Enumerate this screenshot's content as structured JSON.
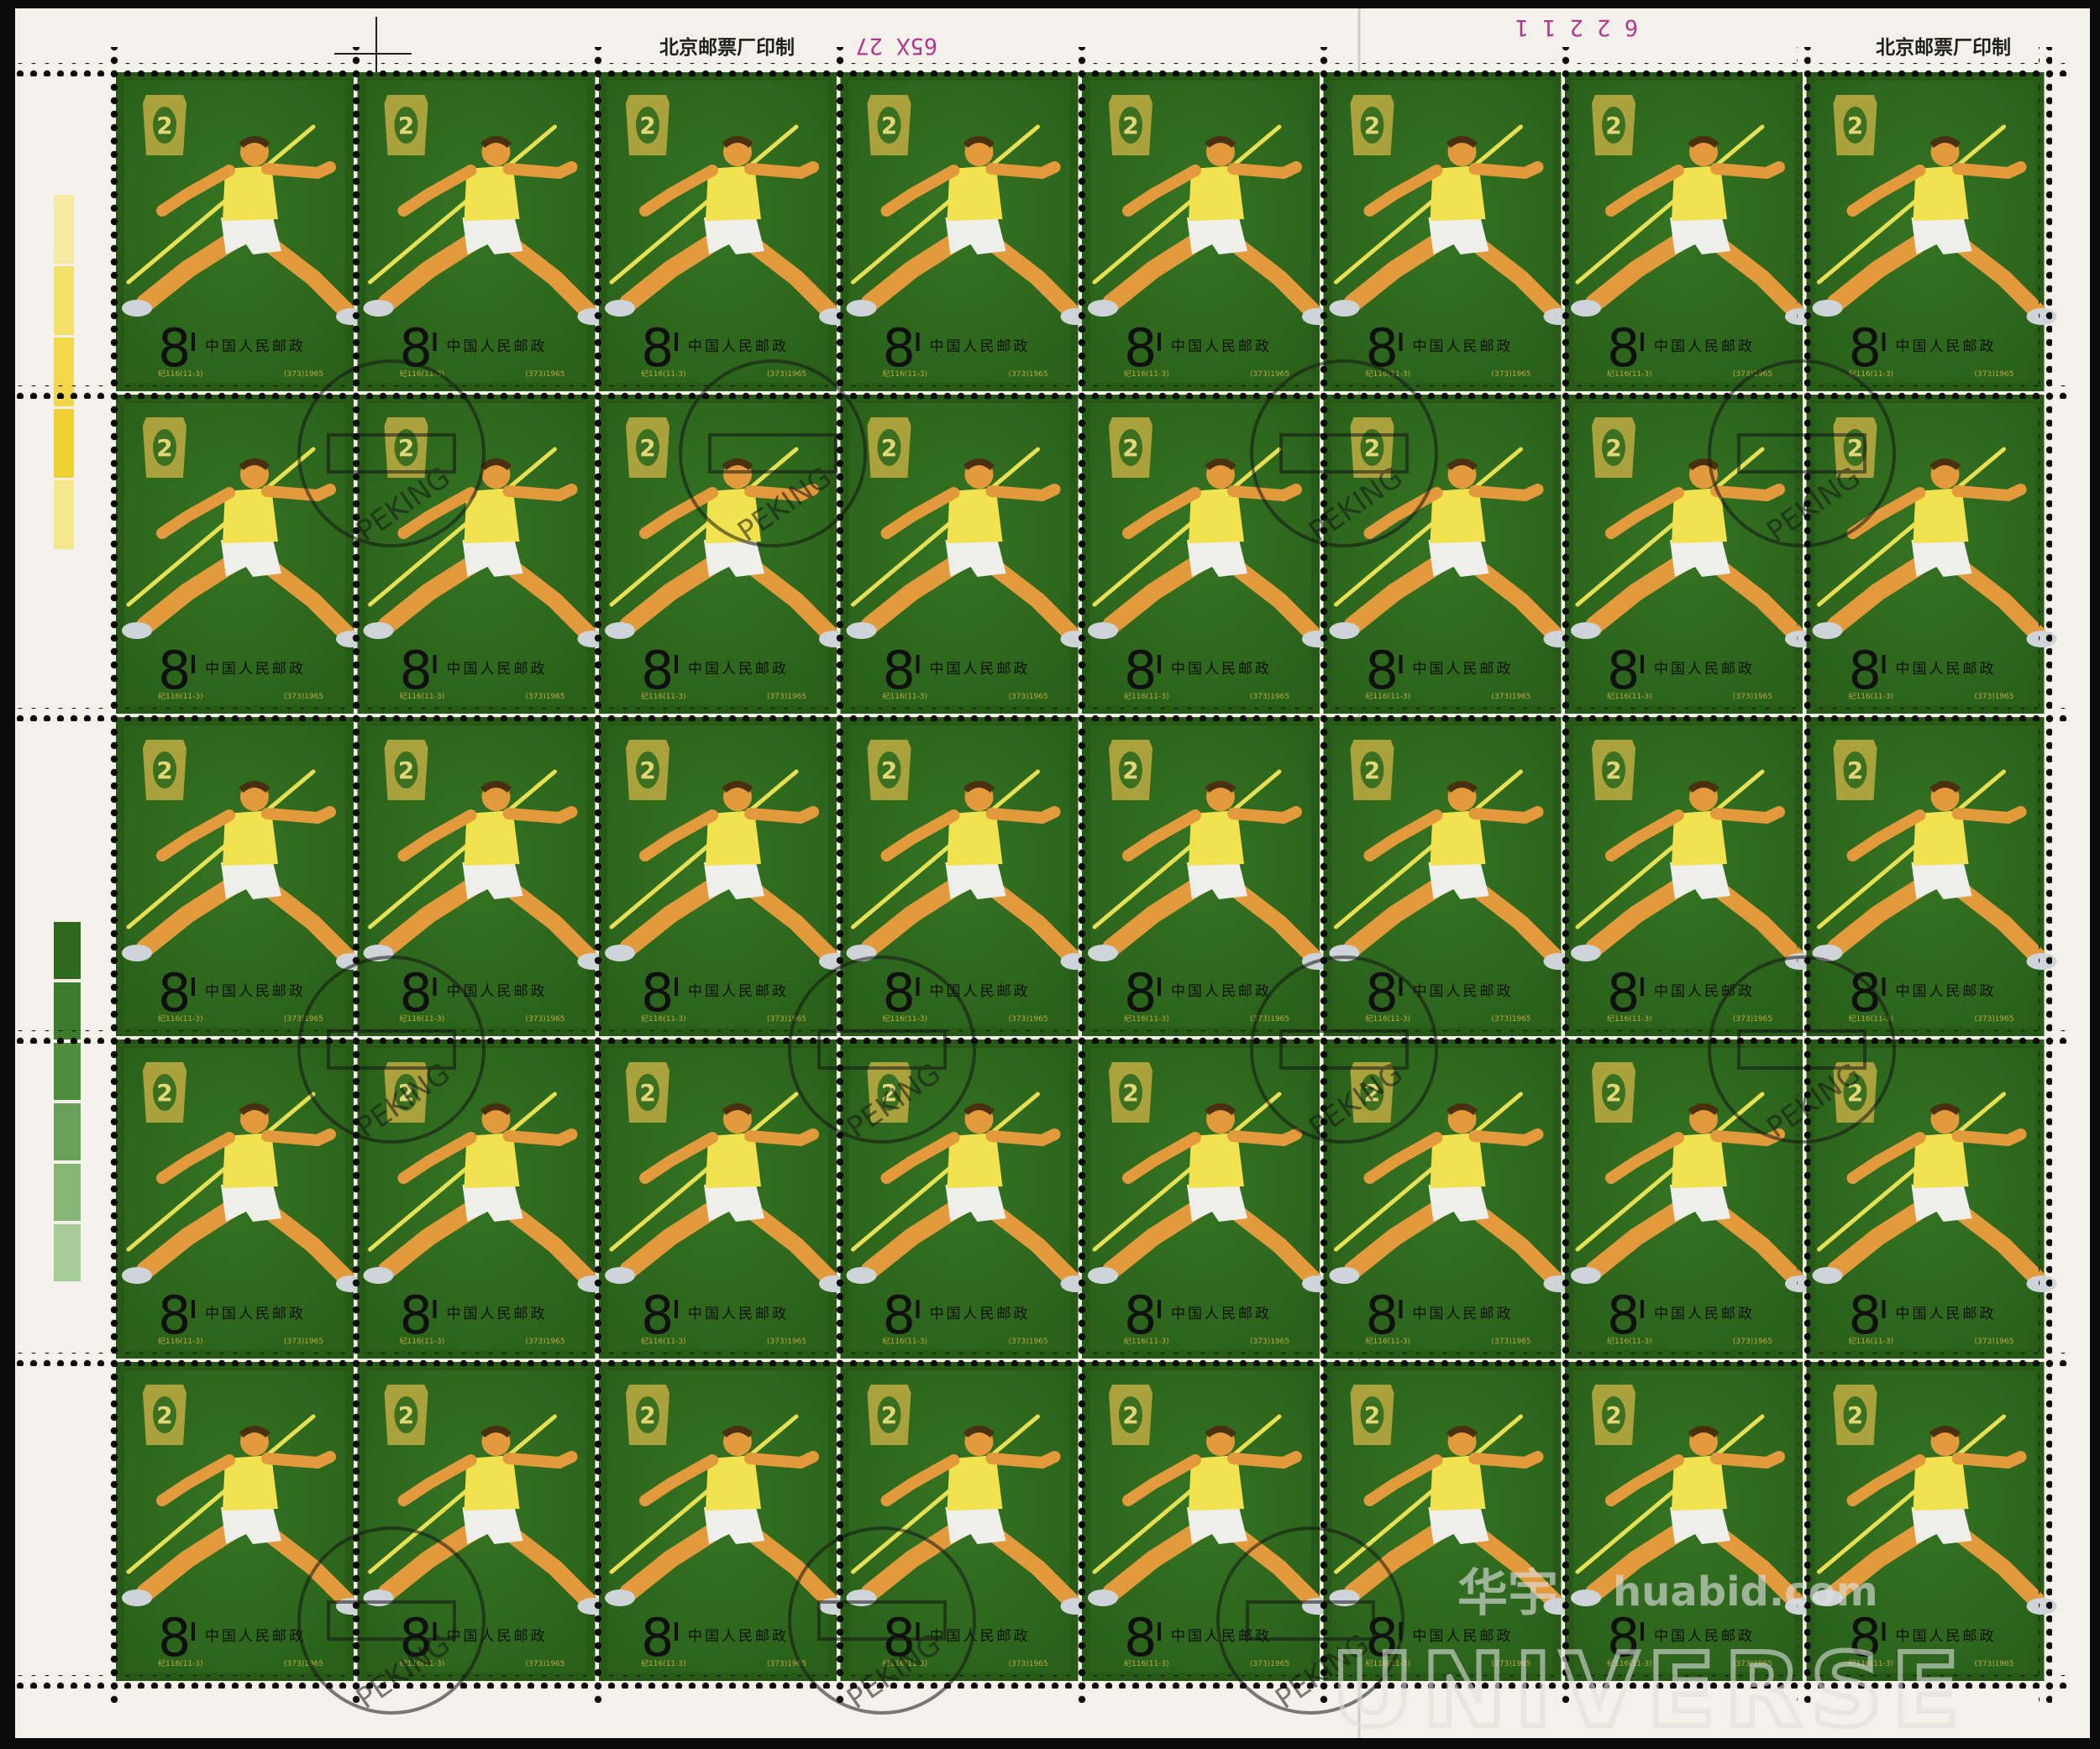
{
  "sheet": {
    "top_imprint_left": "北京邮票厂印制",
    "top_imprint_right": "北京邮票厂印制",
    "control_number_left": "65X 27",
    "control_number_right": "6 2 2 1 1"
  },
  "stamp": {
    "value": "8",
    "country": "中国人民邮政",
    "catalog_code": "纪116(11-3)",
    "catalog_year": "(373)1965",
    "emblem_number": "2",
    "postmark_city": "PEKING",
    "colors": {
      "field_green": "#2f6a1e",
      "field_green_dark": "#275a17",
      "emblem_gold": "#b9a843",
      "shirt_yellow": "#f2e24f",
      "skin_orange": "#e39a3c",
      "shorts_white": "#eeeeea",
      "javelin_yellow": "#e8e054"
    }
  },
  "grid": {
    "columns": 8,
    "rows": 5
  },
  "watermark": {
    "brand_cn": "华宇",
    "url": "huabid.com",
    "brand_en": "UNIVERSE"
  },
  "color_bars": [
    "#f7e9a0",
    "#f5e06a",
    "#f2d74a",
    "#efd033",
    "#f4e78c"
  ],
  "green_bars": [
    "#2f6a1e",
    "#3d7c2c",
    "#4f8d3c",
    "#6aa15a",
    "#86b676",
    "#a6ca98"
  ]
}
